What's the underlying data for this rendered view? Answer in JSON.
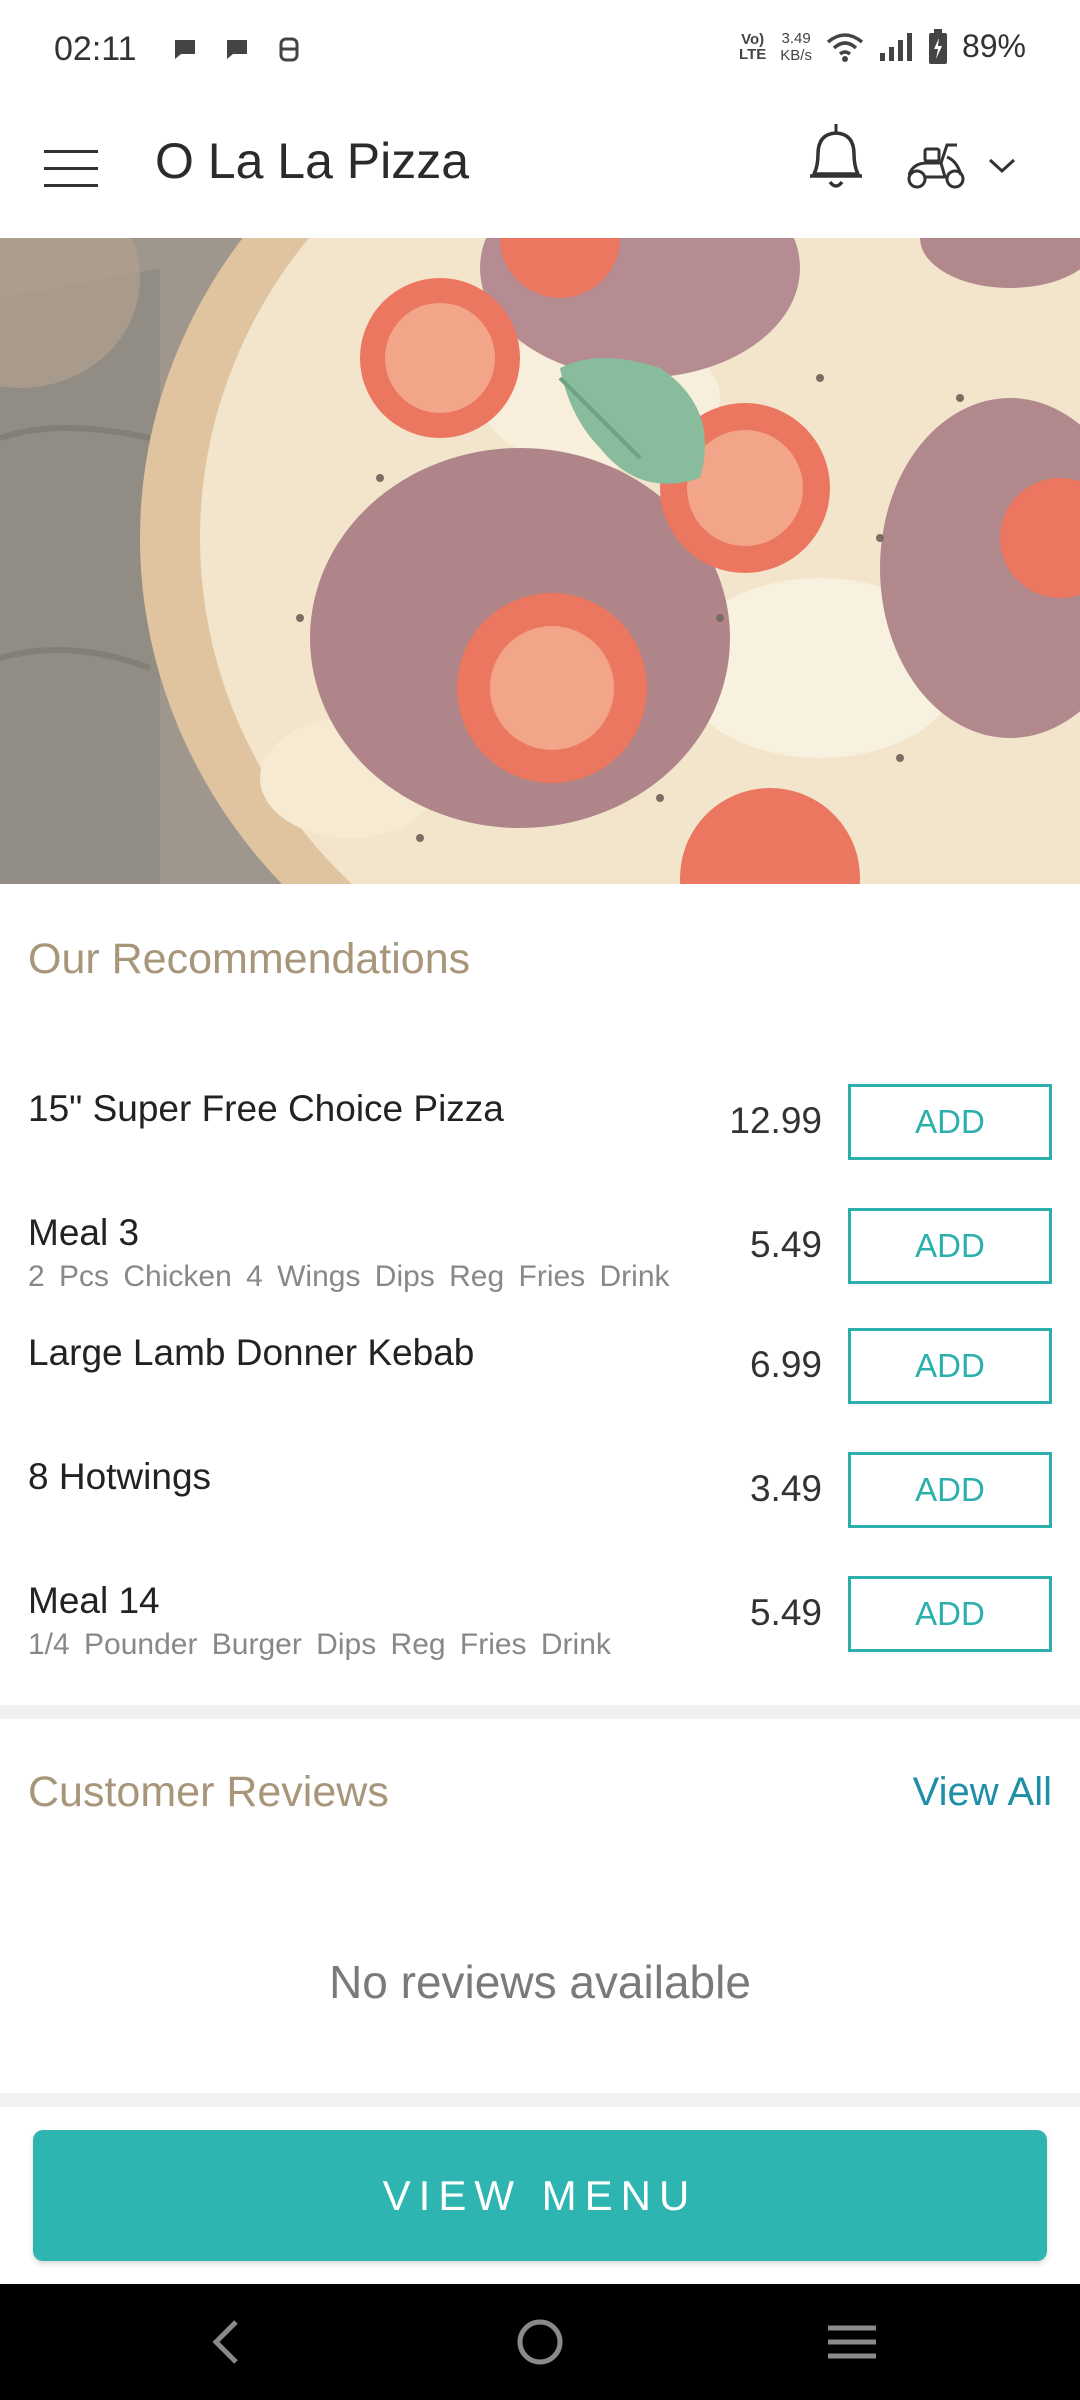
{
  "status_bar": {
    "time": "02:11",
    "net_type": "Vo) LTE",
    "net_type_top": "Vo)",
    "net_type_bottom": "LTE",
    "speed_value": "3.49",
    "speed_unit": "KB/s",
    "battery": "89%"
  },
  "header": {
    "title": "O La La Pizza",
    "icons": [
      "menu-icon",
      "bell-icon",
      "scooter-icon",
      "chevron-down-icon"
    ]
  },
  "recommendations": {
    "title": "Our Recommendations",
    "items": [
      {
        "name": "15\" Super Free Choice Pizza",
        "desc": "",
        "price": "12.99",
        "button": "ADD"
      },
      {
        "name": "Meal 3",
        "desc": "2 Pcs Chicken  4 Wings  Dips  Reg Fries  Drink",
        "price": "5.49",
        "button": "ADD"
      },
      {
        "name": "Large Lamb Donner Kebab",
        "desc": "",
        "price": "6.99",
        "button": "ADD"
      },
      {
        "name": "8 Hotwings",
        "desc": "",
        "price": "3.49",
        "button": "ADD"
      },
      {
        "name": "Meal 14",
        "desc": "1/4 Pounder Burger  Dips  Reg Fries  Drink",
        "price": "5.49",
        "button": "ADD"
      }
    ]
  },
  "reviews": {
    "title": "Customer Reviews",
    "view_all": "View All",
    "empty": "No reviews available"
  },
  "footer": {
    "view_menu": "VIEW MENU"
  },
  "colors": {
    "accent": "#2fb5b1",
    "section_title": "#a8967a",
    "link": "#1e8fa7"
  }
}
